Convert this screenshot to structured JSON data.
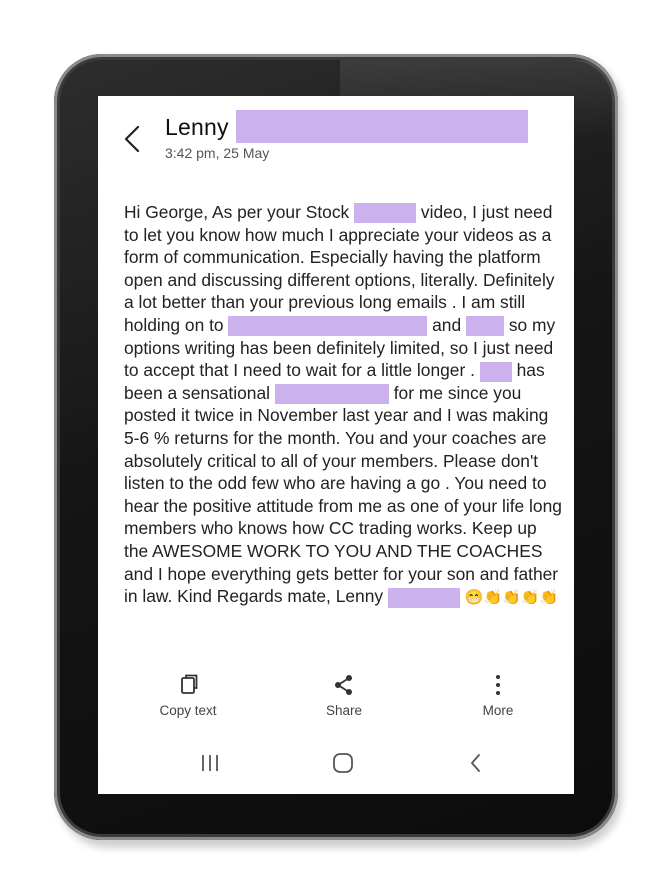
{
  "header": {
    "contact_name": "Lenny",
    "timestamp": "3:42 pm, 25 May"
  },
  "message": {
    "p1": "Hi George, As per your Stock",
    "p2": "video, I just need to let you know how much I appreciate your videos as a form of communication. Especially having the platform open and discussing different options, literally. Definitely a lot better than your previous long emails . I am still holding on to",
    "p3": "and",
    "p4": "so my options writing has been definitely limited, so I just need to accept that I need to wait for a little longer .",
    "p5": "has been a sensational",
    "p6": "for me since you posted it twice in November last year and I was making 5-6 % returns for the month. You and your coaches are absolutely critical to all of your members. Please don't listen to the odd few who are having a go . You need to hear the positive attitude from me as one of your life long members who knows how CC trading works. Keep up the AWESOME WORK TO YOU AND THE COACHES and I hope everything gets better for your son and father in law. Kind Regards mate, Lenny",
    "emojis": "😁👏👏👏👏"
  },
  "actions": {
    "copy_label": "Copy text",
    "share_label": "Share",
    "more_label": "More"
  },
  "icons": {
    "back": "chevron-left-icon",
    "copy": "copy-icon",
    "share": "share-icon",
    "more": "more-vertical-icon",
    "nav_recents": "recents-icon",
    "nav_home": "home-icon",
    "nav_back": "nav-back-icon"
  },
  "colors": {
    "redaction": "#cbb2ef",
    "text": "#222222",
    "bezel": "#151515"
  }
}
